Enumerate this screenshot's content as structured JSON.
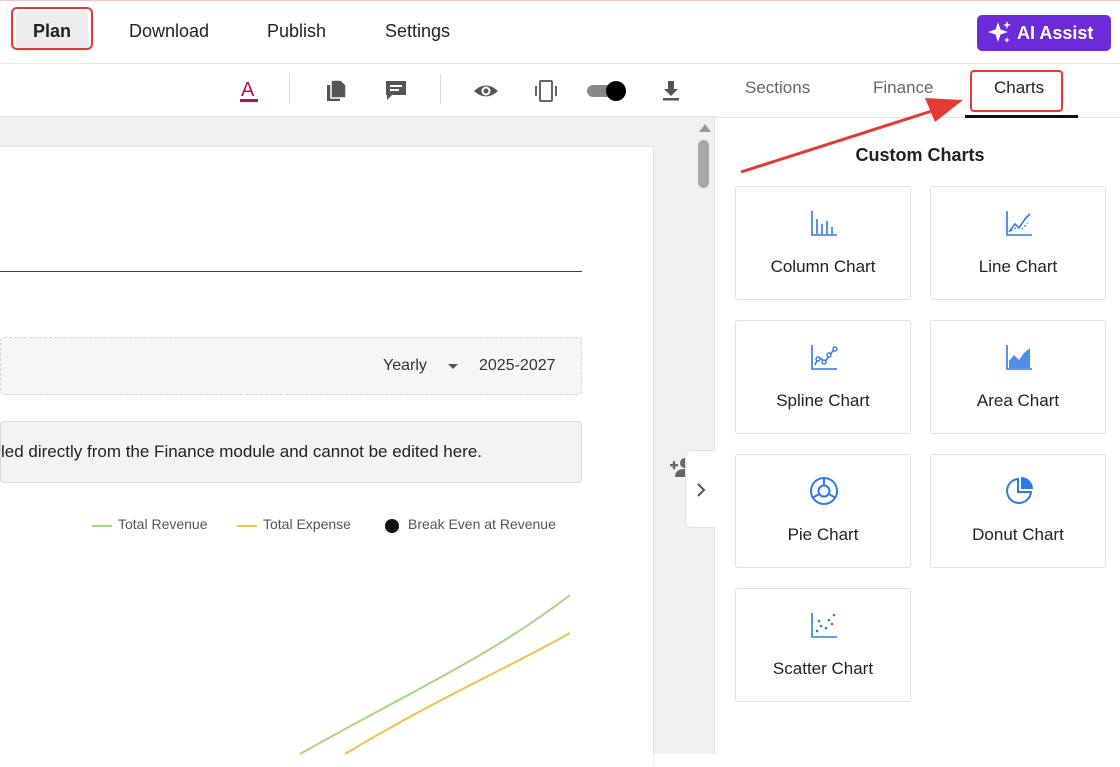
{
  "topnav": {
    "items": [
      "Plan",
      "Download",
      "Publish",
      "Settings"
    ],
    "active": "Plan",
    "ai_assist_label": "AI Assist"
  },
  "colors": {
    "accent_purple": "#6c2bd9",
    "highlight_red": "#e53935",
    "chart_blue": "#2f7ae5",
    "revenue_green": "#a6d785",
    "expense_yellow": "#f0c14b"
  },
  "editor": {
    "toolbar_icons": [
      "text-color-icon",
      "pages-icon",
      "comment-icon",
      "preview-eye-icon",
      "device-preview-icon",
      "toggle-switch",
      "download-icon"
    ],
    "period_select": "Yearly",
    "range": "2025-2027",
    "notice": "led directly from the Finance module and cannot be edited here.",
    "legend": [
      "Total Revenue",
      "Total Expense",
      "Break Even at Revenue"
    ]
  },
  "panel": {
    "tabs": [
      "Sections",
      "Finance",
      "Charts"
    ],
    "active_tab": "Charts",
    "section_title": "Custom Charts",
    "cards": [
      {
        "label": "Column Chart",
        "icon": "column-chart-icon"
      },
      {
        "label": "Line Chart",
        "icon": "line-chart-icon"
      },
      {
        "label": "Spline Chart",
        "icon": "spline-chart-icon"
      },
      {
        "label": "Area Chart",
        "icon": "area-chart-icon"
      },
      {
        "label": "Pie Chart",
        "icon": "pie-chart-icon"
      },
      {
        "label": "Donut Chart",
        "icon": "donut-chart-icon"
      },
      {
        "label": "Scatter Chart",
        "icon": "scatter-chart-icon"
      }
    ]
  }
}
